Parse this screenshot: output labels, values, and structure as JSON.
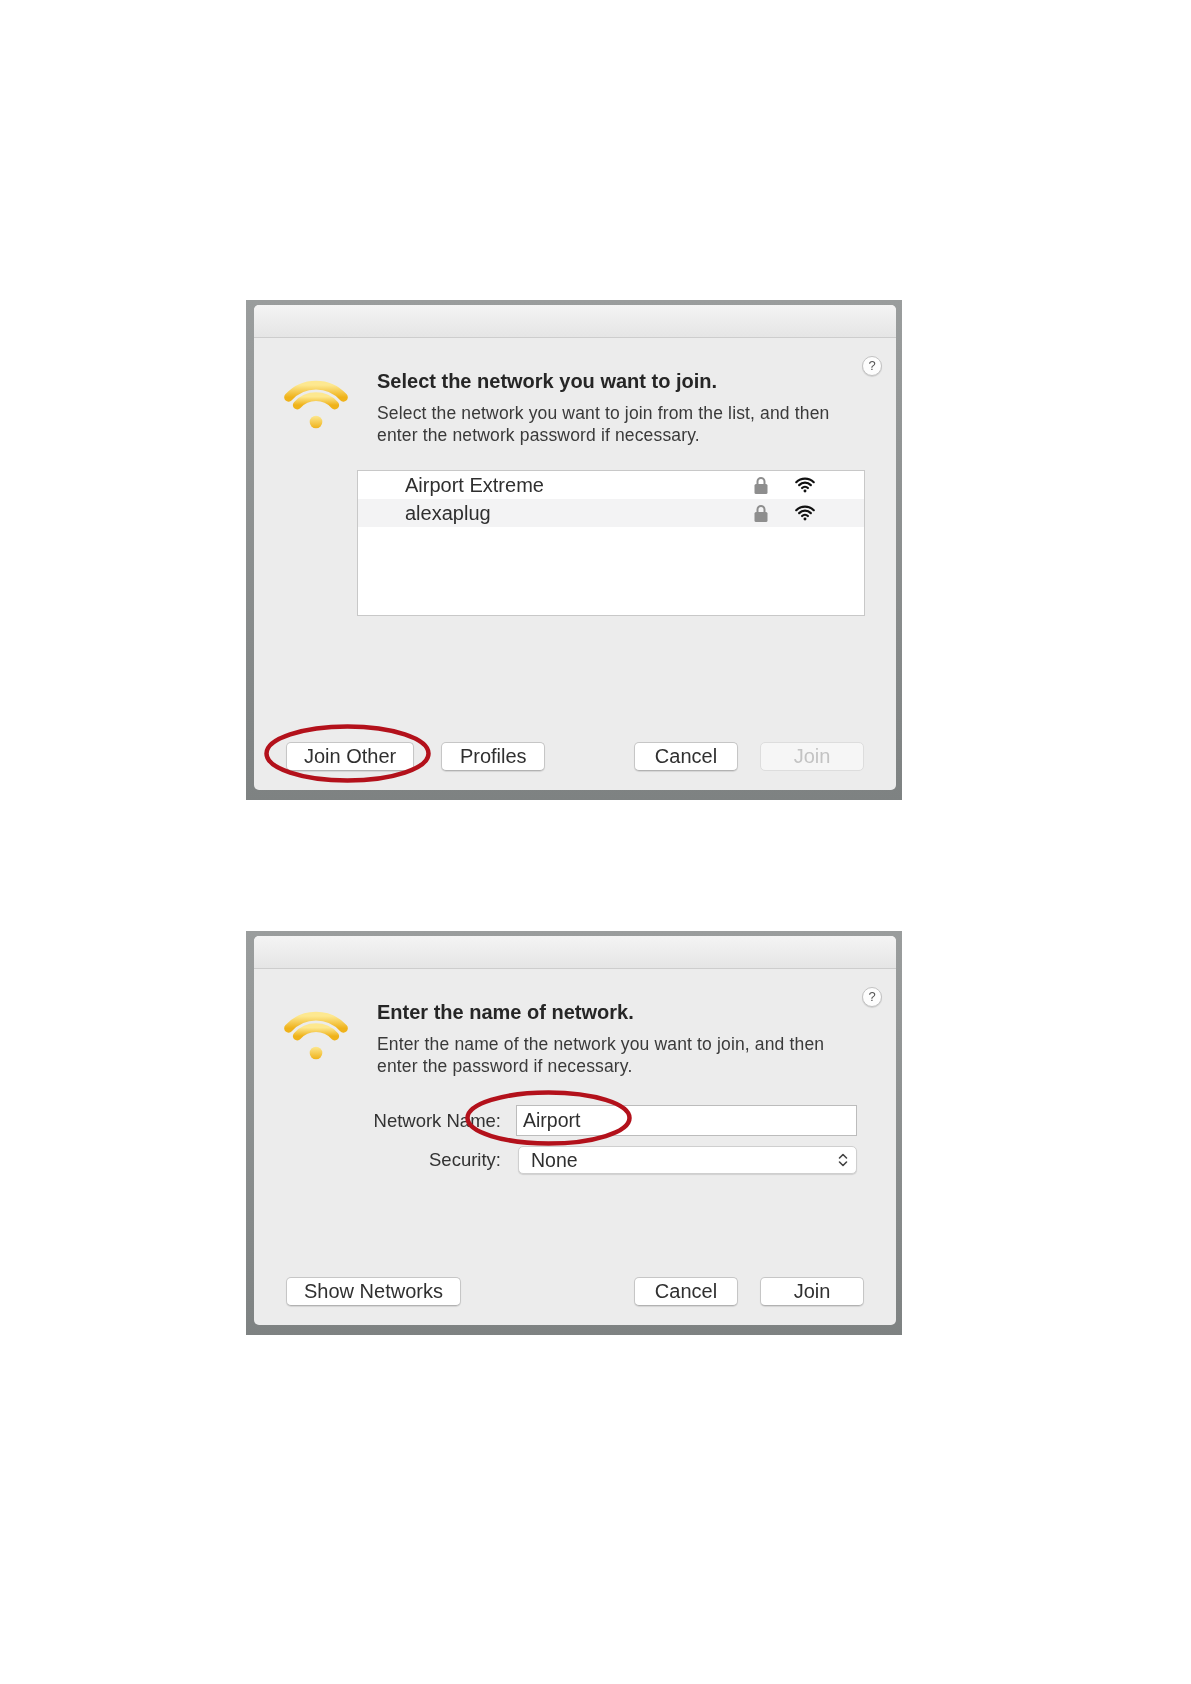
{
  "dialogs": [
    {
      "kind": "network_list",
      "help": "?",
      "heading": "Select the network you want to join.",
      "description": "Select the network you want to join from the list, and then enter the network password if necessary.",
      "networks": [
        {
          "name": "Airport Extreme",
          "locked": true,
          "selected": false
        },
        {
          "name": "alexaplug",
          "locked": true,
          "selected": false
        }
      ],
      "buttons": {
        "left": [
          {
            "label": "Join Other",
            "disabled": false,
            "circled": true
          },
          {
            "label": "Profiles",
            "disabled": false,
            "circled": false
          }
        ],
        "right": [
          {
            "label": "Cancel",
            "disabled": false,
            "circled": false
          },
          {
            "label": "Join",
            "disabled": true,
            "circled": false
          }
        ]
      }
    },
    {
      "kind": "join_other",
      "help": "?",
      "heading": "Enter the name of network.",
      "description": "Enter the name of the network you want to join, and then enter the password if necessary.",
      "fields": [
        {
          "kind": "text",
          "label": "Network Name:",
          "value": "Airport",
          "circled": true
        },
        {
          "kind": "select",
          "label": "Security:",
          "value": "None",
          "circled": false
        }
      ],
      "buttons": {
        "left": [
          {
            "label": "Show Networks",
            "disabled": false,
            "circled": false
          }
        ],
        "right": [
          {
            "label": "Cancel",
            "disabled": false,
            "circled": false
          },
          {
            "label": "Join",
            "disabled": false,
            "circled": false
          }
        ]
      }
    }
  ]
}
